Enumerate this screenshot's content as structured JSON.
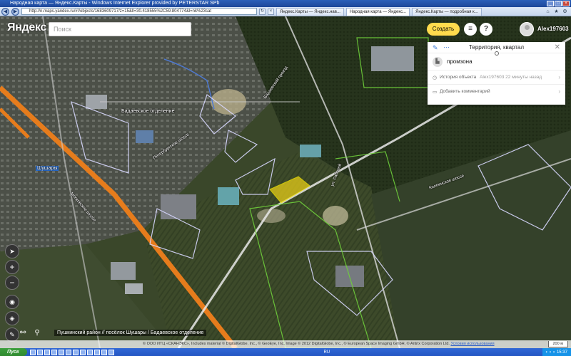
{
  "browser": {
    "window_title": "Народная карта — Яндекс.Карты - Windows Internet Explorer provided by PETERSTAR SPb",
    "address": "http://n.maps.yandex.ru/#!/objects/1683609717/z=15&ll=30.418555%2C59.804774&l=nk%23sat",
    "tabs": [
      "Яндекс.Карты — Яндекс.нав...",
      "Народная карта — Яндекс...",
      "Яндекс.Карты — подробная к..."
    ]
  },
  "header": {
    "logo": "Яндекс",
    "search_placeholder": "Поиск",
    "create_label": "Создать",
    "help_label": "?",
    "username": "Alex197603"
  },
  "panel": {
    "title": "Территория, квартал",
    "category": "промзона",
    "history_label": "История объекта",
    "history_value": "Alex197603 22 минуты назад",
    "comment_label": "Добавить комментарий"
  },
  "map": {
    "labels": {
      "badavskoe": "Бадаевское отделение",
      "shushary": "Шушары",
      "road_petersburg": "Петербургское шоссе",
      "road_badaevsky": "Бадаевский проезд",
      "road_moskovskoe": "Московское шоссе",
      "road_kolpinskoe": "Колпинское шоссе",
      "road_rabochey": "ул. Рабочей"
    },
    "breadcrumb": "Пушкинский район // посёлок Шушары / Бадаевское отделение"
  },
  "copyright": {
    "text": "© ООО ИТЦ «СКАНЭКС», Includes material © DigitalGlobe, Inc., © GeoEye, Inc, Image © 2012 DigitalGlobe, Inc., © European Space Imaging GmbH, © Antrix Corporation Ltd.",
    "terms": "Условия использования",
    "scale": "200 м"
  },
  "taskbar": {
    "start": "Пуск",
    "lang": "RU",
    "clock": "15:37"
  }
}
